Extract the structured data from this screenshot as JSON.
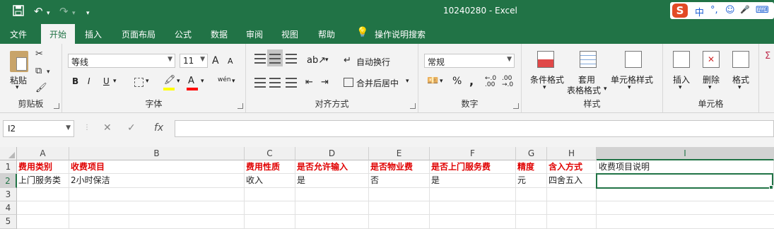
{
  "app": {
    "title": "10240280 - Excel"
  },
  "ime": {
    "logo": "S",
    "lang": "中",
    "punct": "°,",
    "emoji": "☺",
    "mic": "🎤",
    "kbd": "⌨"
  },
  "tabs": [
    "文件",
    "开始",
    "插入",
    "页面布局",
    "公式",
    "数据",
    "审阅",
    "视图",
    "帮助",
    "操作说明搜索"
  ],
  "ribbon": {
    "clipboard": {
      "label": "剪贴板",
      "paste": "粘贴"
    },
    "font": {
      "label": "字体",
      "name": "等线",
      "size": "11",
      "bold": "B",
      "italic": "I",
      "underline": "U",
      "grow": "A",
      "shrink": "A",
      "wen": "wén"
    },
    "align": {
      "label": "对齐方式",
      "wrap": "自动换行",
      "merge": "合并后居中"
    },
    "number": {
      "label": "数字",
      "format": "常规",
      "percent": "%",
      "comma": ","
    },
    "styles": {
      "label": "样式",
      "cond": "条件格式",
      "table1": "套用",
      "table2": "表格格式",
      "cellstyle": "单元格样式"
    },
    "cells": {
      "label": "单元格",
      "insert": "插入",
      "delete": "删除",
      "format": "格式"
    }
  },
  "formula": {
    "namebox": "I2",
    "value": ""
  },
  "columns": [
    "A",
    "B",
    "C",
    "D",
    "E",
    "F",
    "G",
    "H",
    "I"
  ],
  "rows": [
    "1",
    "2",
    "3",
    "4",
    "5"
  ],
  "cells": {
    "row1": [
      "费用类别",
      "收费项目",
      "费用性质",
      "是否允许输入",
      "是否物业费",
      "是否上门服务费",
      "精度",
      "含入方式",
      "收费项目说明"
    ],
    "row2": [
      "上门服务类",
      "2小时保洁",
      "收入",
      "是",
      "否",
      "是",
      "元",
      "四舍五入",
      ""
    ]
  },
  "colors": {
    "accent": "#217346",
    "header_text": "#e00000"
  }
}
